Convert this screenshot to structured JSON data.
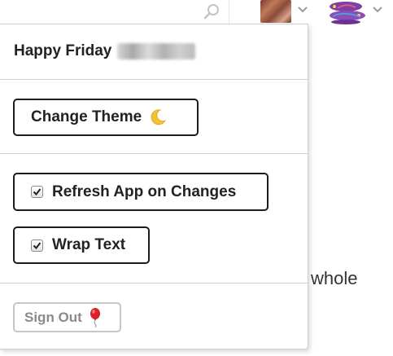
{
  "topbar": {
    "icons": [
      "search-icon",
      "user-avatar",
      "chevron-down-icon",
      "team-logo",
      "chevron-down-icon"
    ]
  },
  "background": {
    "visible_text": "whole"
  },
  "menu": {
    "greeting": "Happy Friday",
    "change_theme_label": "Change Theme",
    "change_theme_icon": "crescent-moon-icon",
    "refresh_app_label": "Refresh App on Changes",
    "refresh_app_checked": true,
    "wrap_text_label": "Wrap Text",
    "wrap_text_checked": true,
    "sign_out_label": "Sign Out",
    "sign_out_icon": "balloon-icon"
  },
  "colors": {
    "button_border": "#1c1c1c",
    "sign_out_text": "#8a8a8a",
    "balloon": "#d8232a",
    "moon": "#f2c230"
  }
}
